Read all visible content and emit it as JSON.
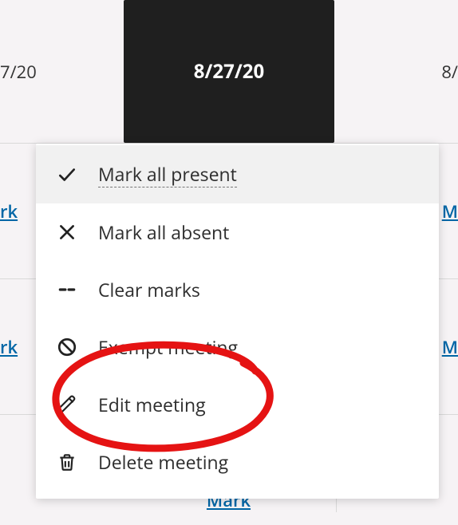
{
  "header": {
    "dates": {
      "left_partial": "7/20",
      "center": "8/27/20",
      "right_partial": "8/"
    }
  },
  "cells": {
    "mark_label": "Mark",
    "mark_left_partial": "rk",
    "mark_right_partial": "M"
  },
  "menu": {
    "items": [
      {
        "label": "Mark all present",
        "icon": "check-icon",
        "hovered": true
      },
      {
        "label": "Mark all absent",
        "icon": "x-icon"
      },
      {
        "label": "Clear marks",
        "icon": "dashes-icon"
      },
      {
        "label": "Exempt meeting",
        "icon": "prohibit-icon"
      },
      {
        "label": "Edit meeting",
        "icon": "pencil-icon",
        "annotated": true
      },
      {
        "label": "Delete meeting",
        "icon": "trash-icon"
      }
    ]
  },
  "annotation": {
    "color": "#e51313"
  }
}
